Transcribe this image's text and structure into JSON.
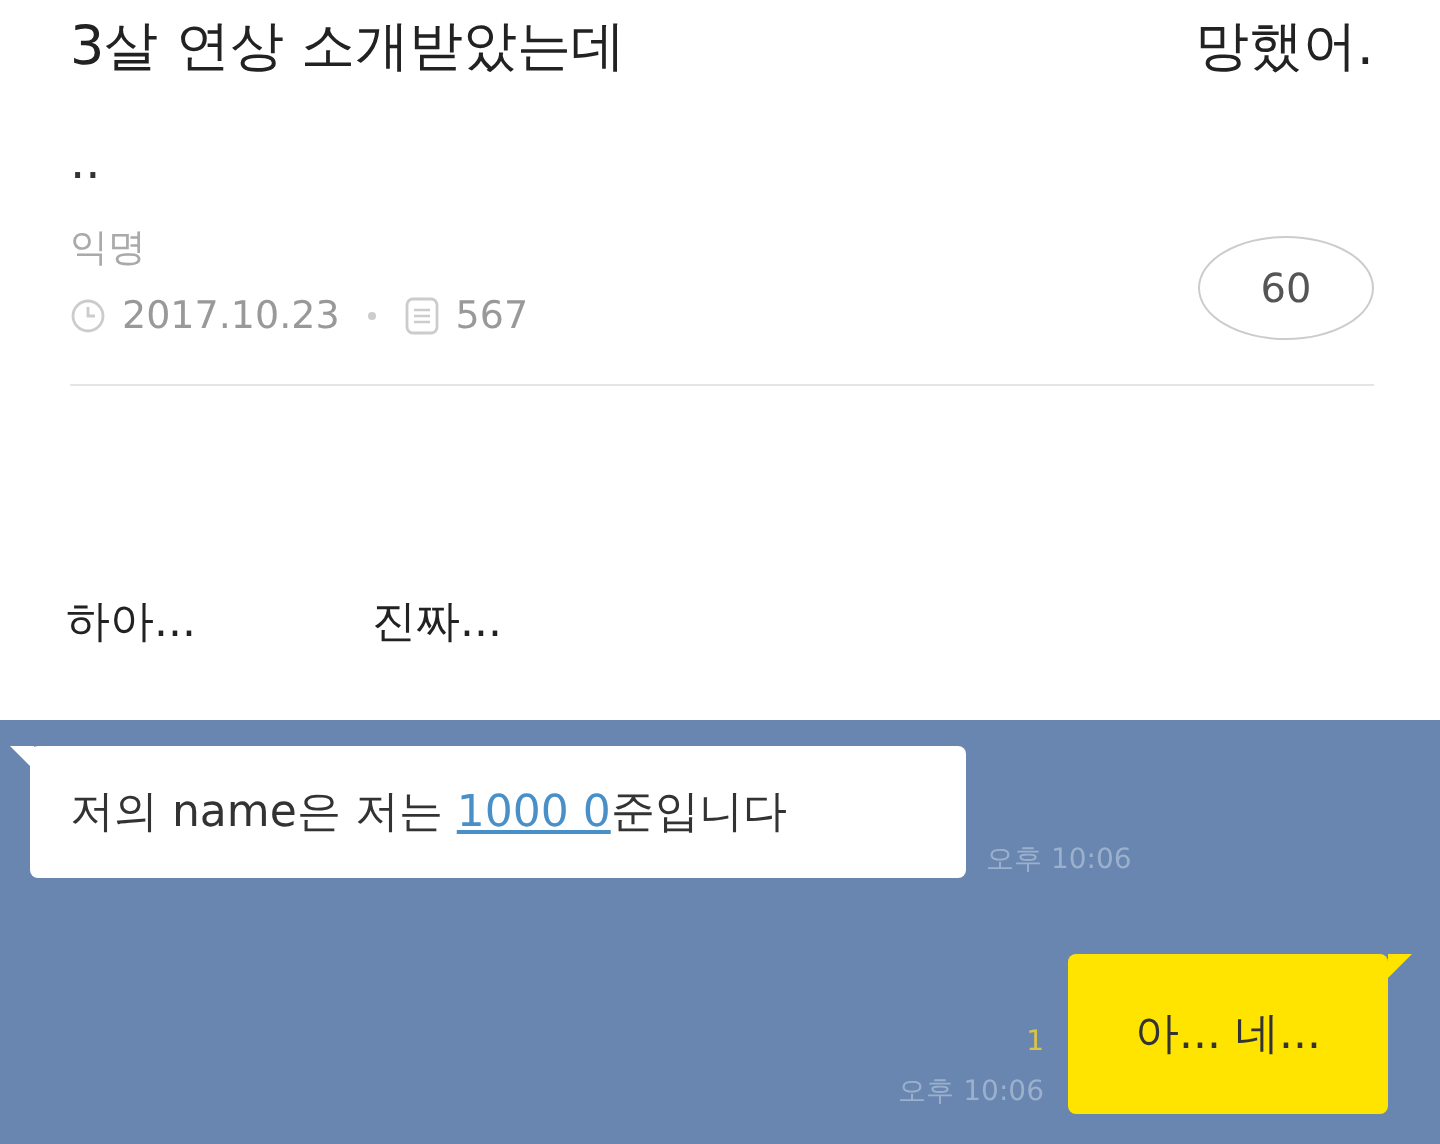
{
  "post": {
    "title_parts": [
      "3살 연상 소개받았는데",
      "망했어."
    ],
    "title_continuation": "..",
    "author": "익명",
    "date": "2017.10.23",
    "views": "567",
    "comment_count": "60"
  },
  "body": [
    "하아...",
    "진짜..."
  ],
  "chat": {
    "messages": [
      {
        "kind": "received",
        "text_before": "저의 name은 저는 ",
        "link": "1000 0",
        "text_after": "준입니다",
        "time": "오후 10:06"
      },
      {
        "kind": "sent",
        "text": "아... 네...",
        "unread": "1",
        "time": "오후 10:06"
      }
    ]
  }
}
